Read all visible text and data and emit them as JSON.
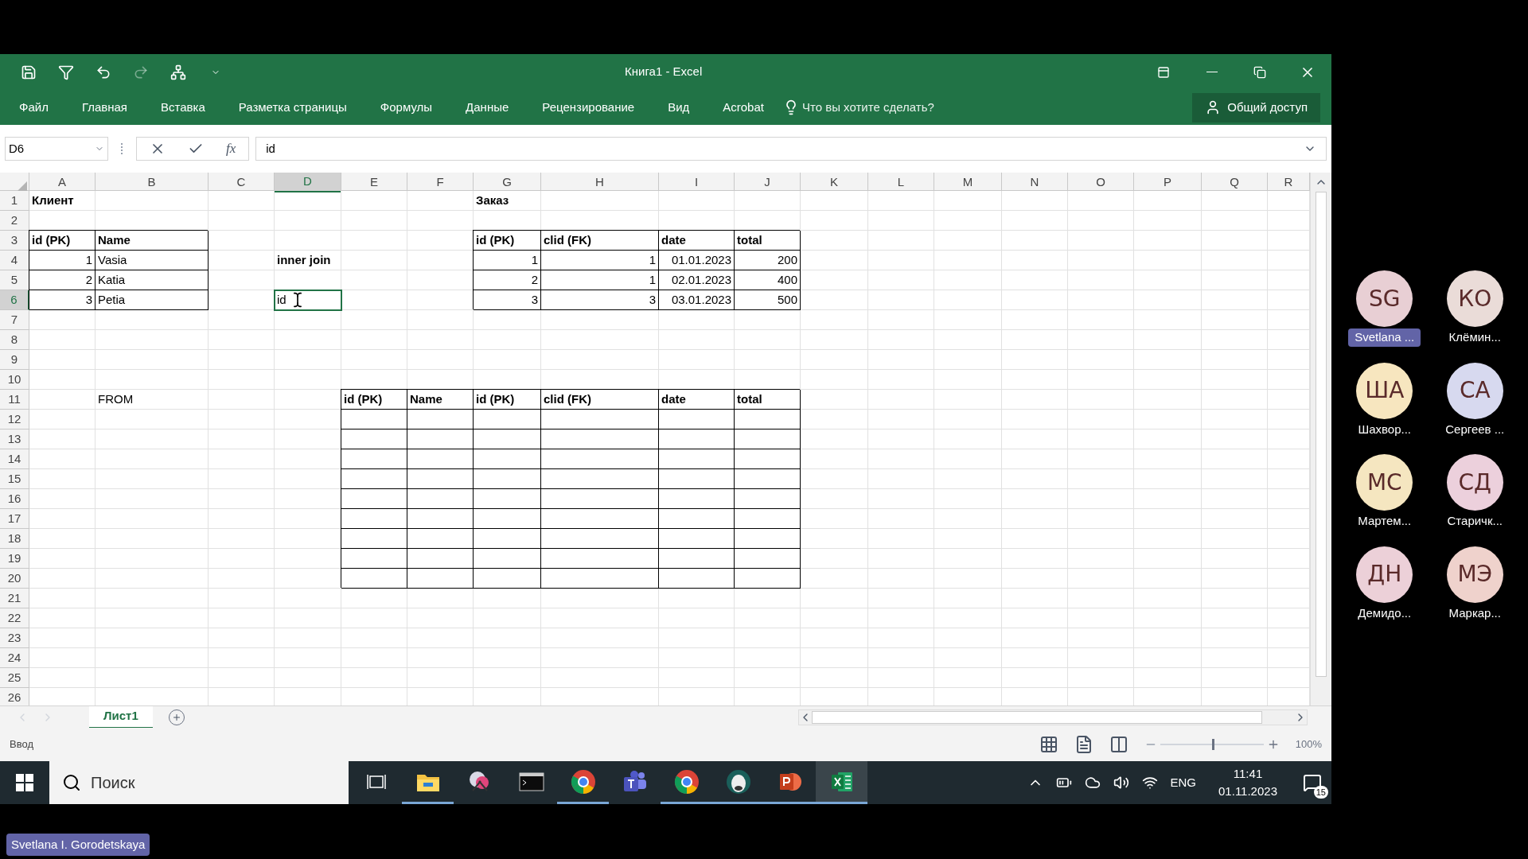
{
  "window": {
    "title": "Книга1 - Excel"
  },
  "quick_access": [
    {
      "kind": "save",
      "disabled": false
    },
    {
      "kind": "filter",
      "disabled": false
    },
    {
      "kind": "undo",
      "disabled": false
    },
    {
      "kind": "redo",
      "disabled": true
    },
    {
      "kind": "tree",
      "disabled": false
    },
    {
      "kind": "customize",
      "disabled": false
    }
  ],
  "ribbon_tabs": [
    {
      "label": "Файл"
    },
    {
      "label": "Главная"
    },
    {
      "label": "Вставка"
    },
    {
      "label": "Разметка страницы"
    },
    {
      "label": "Формулы"
    },
    {
      "label": "Данные"
    },
    {
      "label": "Рецензирование"
    },
    {
      "label": "Вид"
    },
    {
      "label": "Acrobat"
    }
  ],
  "tell_me": {
    "placeholder": "Что вы хотите сделать?"
  },
  "share_button": "Общий доступ",
  "formula_bar": {
    "name_box": "D6",
    "fx": "fx",
    "value": "id"
  },
  "sheet": {
    "columns": [
      {
        "label": "A",
        "selected": false
      },
      {
        "label": "B",
        "selected": false
      },
      {
        "label": "C",
        "selected": false
      },
      {
        "label": "D",
        "selected": true
      },
      {
        "label": "E",
        "selected": false
      },
      {
        "label": "F",
        "selected": false
      },
      {
        "label": "G",
        "selected": false
      },
      {
        "label": "H",
        "selected": false
      },
      {
        "label": "I",
        "selected": false
      },
      {
        "label": "J",
        "selected": false
      },
      {
        "label": "K",
        "selected": false
      },
      {
        "label": "L",
        "selected": false
      },
      {
        "label": "M",
        "selected": false
      },
      {
        "label": "N",
        "selected": false
      },
      {
        "label": "O",
        "selected": false
      },
      {
        "label": "P",
        "selected": false
      },
      {
        "label": "Q",
        "selected": false
      },
      {
        "label": "R",
        "selected": false
      }
    ],
    "rows": [
      {
        "number": "1",
        "selected": false,
        "cells": {
          "A": {
            "text": "Клиент",
            "bold": true
          },
          "G": {
            "text": "Заказ",
            "bold": true
          }
        }
      },
      {
        "number": "2",
        "selected": false,
        "cells": {}
      },
      {
        "number": "3",
        "selected": false,
        "cells": {
          "A": {
            "text": "id (PK)",
            "bold": true,
            "bordered": true
          },
          "B": {
            "text": "Name",
            "bold": true,
            "bordered": true
          },
          "G": {
            "text": "id (PK)",
            "bold": true,
            "bordered": true
          },
          "H": {
            "text": "clid (FK)",
            "bold": true,
            "bordered": true
          },
          "I": {
            "text": "date",
            "bold": true,
            "bordered": true
          },
          "J": {
            "text": "total",
            "bold": true,
            "bordered": true
          }
        }
      },
      {
        "number": "4",
        "selected": false,
        "cells": {
          "A": {
            "text": "1",
            "numeric": true,
            "bordered": true
          },
          "B": {
            "text": "Vasia",
            "bordered": true
          },
          "D": {
            "text": "inner join",
            "bold": true
          },
          "G": {
            "text": "1",
            "numeric": true,
            "bordered": true
          },
          "H": {
            "text": "1",
            "numeric": true,
            "bordered": true
          },
          "I": {
            "text": "01.01.2023",
            "numeric": true,
            "bordered": true
          },
          "J": {
            "text": "200",
            "numeric": true,
            "bordered": true
          }
        }
      },
      {
        "number": "5",
        "selected": false,
        "cells": {
          "A": {
            "text": "2",
            "numeric": true,
            "bordered": true
          },
          "B": {
            "text": "Katia",
            "bordered": true
          },
          "G": {
            "text": "2",
            "numeric": true,
            "bordered": true
          },
          "H": {
            "text": "1",
            "numeric": true,
            "bordered": true
          },
          "I": {
            "text": "02.01.2023",
            "numeric": true,
            "bordered": true
          },
          "J": {
            "text": "400",
            "numeric": true,
            "bordered": true
          }
        }
      },
      {
        "number": "6",
        "selected": true,
        "cells": {
          "A": {
            "text": "3",
            "numeric": true,
            "bordered": true
          },
          "B": {
            "text": "Petia",
            "bordered": true
          },
          "D": {
            "text": "id",
            "selected": true
          },
          "G": {
            "text": "3",
            "numeric": true,
            "bordered": true
          },
          "H": {
            "text": "3",
            "numeric": true,
            "bordered": true
          },
          "I": {
            "text": "03.01.2023",
            "numeric": true,
            "bordered": true
          },
          "J": {
            "text": "500",
            "numeric": true,
            "bordered": true
          }
        }
      },
      {
        "number": "7",
        "selected": false,
        "cells": {}
      },
      {
        "number": "8",
        "selected": false,
        "cells": {}
      },
      {
        "number": "9",
        "selected": false,
        "cells": {}
      },
      {
        "number": "10",
        "selected": false,
        "cells": {}
      },
      {
        "number": "11",
        "selected": false,
        "cells": {
          "B": {
            "text": "FROM"
          },
          "E": {
            "text": "id (PK)",
            "bold": true,
            "bordered": true
          },
          "F": {
            "text": "Name",
            "bold": true,
            "bordered": true
          },
          "G": {
            "text": "id (PK)",
            "bold": true,
            "bordered": true
          },
          "H": {
            "text": "clid (FK)",
            "bold": true,
            "bordered": true
          },
          "I": {
            "text": "date",
            "bold": true,
            "bordered": true
          },
          "J": {
            "text": "total",
            "bold": true,
            "bordered": true
          }
        }
      },
      {
        "number": "12",
        "selected": false,
        "cells": {
          "E": {
            "bordered": true
          },
          "F": {
            "bordered": true
          },
          "G": {
            "bordered": true
          },
          "H": {
            "bordered": true
          },
          "I": {
            "bordered": true
          },
          "J": {
            "bordered": true
          }
        }
      },
      {
        "number": "13",
        "selected": false,
        "cells": {
          "E": {
            "bordered": true
          },
          "F": {
            "bordered": true
          },
          "G": {
            "bordered": true
          },
          "H": {
            "bordered": true
          },
          "I": {
            "bordered": true
          },
          "J": {
            "bordered": true
          }
        }
      },
      {
        "number": "14",
        "selected": false,
        "cells": {
          "E": {
            "bordered": true
          },
          "F": {
            "bordered": true
          },
          "G": {
            "bordered": true
          },
          "H": {
            "bordered": true
          },
          "I": {
            "bordered": true
          },
          "J": {
            "bordered": true
          }
        }
      },
      {
        "number": "15",
        "selected": false,
        "cells": {
          "E": {
            "bordered": true
          },
          "F": {
            "bordered": true
          },
          "G": {
            "bordered": true
          },
          "H": {
            "bordered": true
          },
          "I": {
            "bordered": true
          },
          "J": {
            "bordered": true
          }
        }
      },
      {
        "number": "16",
        "selected": false,
        "cells": {
          "E": {
            "bordered": true
          },
          "F": {
            "bordered": true
          },
          "G": {
            "bordered": true
          },
          "H": {
            "bordered": true
          },
          "I": {
            "bordered": true
          },
          "J": {
            "bordered": true
          }
        }
      },
      {
        "number": "17",
        "selected": false,
        "cells": {
          "E": {
            "bordered": true
          },
          "F": {
            "bordered": true
          },
          "G": {
            "bordered": true
          },
          "H": {
            "bordered": true
          },
          "I": {
            "bordered": true
          },
          "J": {
            "bordered": true
          }
        }
      },
      {
        "number": "18",
        "selected": false,
        "cells": {
          "E": {
            "bordered": true
          },
          "F": {
            "bordered": true
          },
          "G": {
            "bordered": true
          },
          "H": {
            "bordered": true
          },
          "I": {
            "bordered": true
          },
          "J": {
            "bordered": true
          }
        }
      },
      {
        "number": "19",
        "selected": false,
        "cells": {
          "E": {
            "bordered": true
          },
          "F": {
            "bordered": true
          },
          "G": {
            "bordered": true
          },
          "H": {
            "bordered": true
          },
          "I": {
            "bordered": true
          },
          "J": {
            "bordered": true
          }
        }
      },
      {
        "number": "20",
        "selected": false,
        "cells": {
          "E": {
            "bordered": true
          },
          "F": {
            "bordered": true
          },
          "G": {
            "bordered": true
          },
          "H": {
            "bordered": true
          },
          "I": {
            "bordered": true
          },
          "J": {
            "bordered": true
          }
        }
      },
      {
        "number": "21",
        "selected": false,
        "cells": {}
      },
      {
        "number": "22",
        "selected": false,
        "cells": {}
      },
      {
        "number": "23",
        "selected": false,
        "cells": {}
      },
      {
        "number": "24",
        "selected": false,
        "cells": {}
      },
      {
        "number": "25",
        "selected": false,
        "cells": {}
      },
      {
        "number": "26",
        "selected": false,
        "cells": {}
      }
    ]
  },
  "sheet_tabs": [
    {
      "label": "Лист1",
      "selected": true
    }
  ],
  "status_bar": {
    "mode": "Ввод",
    "zoom": {
      "level": 0.5,
      "reading": "100%"
    }
  },
  "taskbar": {
    "search": {
      "placeholder": "Поиск"
    },
    "apps": [
      {
        "kind": "taskview",
        "running": false,
        "active": false
      },
      {
        "kind": "explorer",
        "running": true,
        "active": false
      },
      {
        "kind": "snip",
        "running": false,
        "active": false
      },
      {
        "kind": "terminal",
        "running": false,
        "active": false
      },
      {
        "kind": "chrome",
        "running": true,
        "active": false
      },
      {
        "kind": "teams",
        "running": false,
        "active": false
      },
      {
        "kind": "chrome",
        "running": true,
        "active": false
      },
      {
        "kind": "mascot",
        "running": true,
        "active": false
      },
      {
        "kind": "powerpoint",
        "running": true,
        "active": false
      },
      {
        "kind": "excel",
        "running": true,
        "active": true
      }
    ],
    "language": "ENG",
    "time": "11:41",
    "date": "01.11.2023",
    "notifications": "15"
  },
  "participants": [
    {
      "initials": "SG",
      "name": "Svetlana ...",
      "speaking": true,
      "color": "#e8cfd4"
    },
    {
      "initials": "КО",
      "name": "Клёмин...",
      "speaking": false,
      "color": "#eadcd8"
    },
    {
      "initials": "ША",
      "name": "Шахвор...",
      "speaking": false,
      "color": "#f7e6bf"
    },
    {
      "initials": "СА",
      "name": "Сергеев ...",
      "speaking": false,
      "color": "#d7d9ef"
    },
    {
      "initials": "МС",
      "name": "Мартем...",
      "speaking": false,
      "color": "#f5e6c0"
    },
    {
      "initials": "СД",
      "name": "Старичк...",
      "speaking": false,
      "color": "#ecd0dc"
    },
    {
      "initials": "ДН",
      "name": "Демидо...",
      "speaking": false,
      "color": "#ecd0d8"
    },
    {
      "initials": "МЭ",
      "name": "Маркар...",
      "speaking": false,
      "color": "#efd2cc"
    }
  ],
  "presenter_label": "Svetlana I. Gorodetskaya"
}
